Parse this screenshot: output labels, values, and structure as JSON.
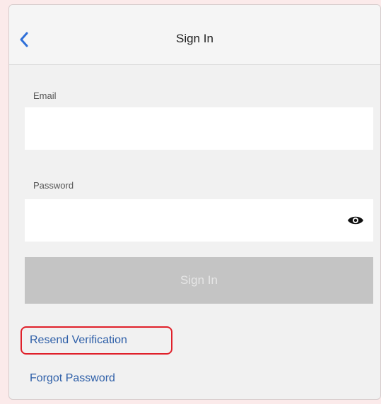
{
  "header": {
    "title": "Sign In",
    "back_icon": "chevron-left-icon"
  },
  "form": {
    "email_label": "Email",
    "email_value": "",
    "password_label": "Password",
    "password_value": "",
    "password_toggle_icon": "eye-icon",
    "submit_label": "Sign In"
  },
  "links": {
    "resend_verification": "Resend Verification",
    "forgot_password": "Forgot Password"
  },
  "colors": {
    "accent": "#2e5fa8",
    "highlight": "#e0202a",
    "disabled_button": "#c4c4c4"
  }
}
